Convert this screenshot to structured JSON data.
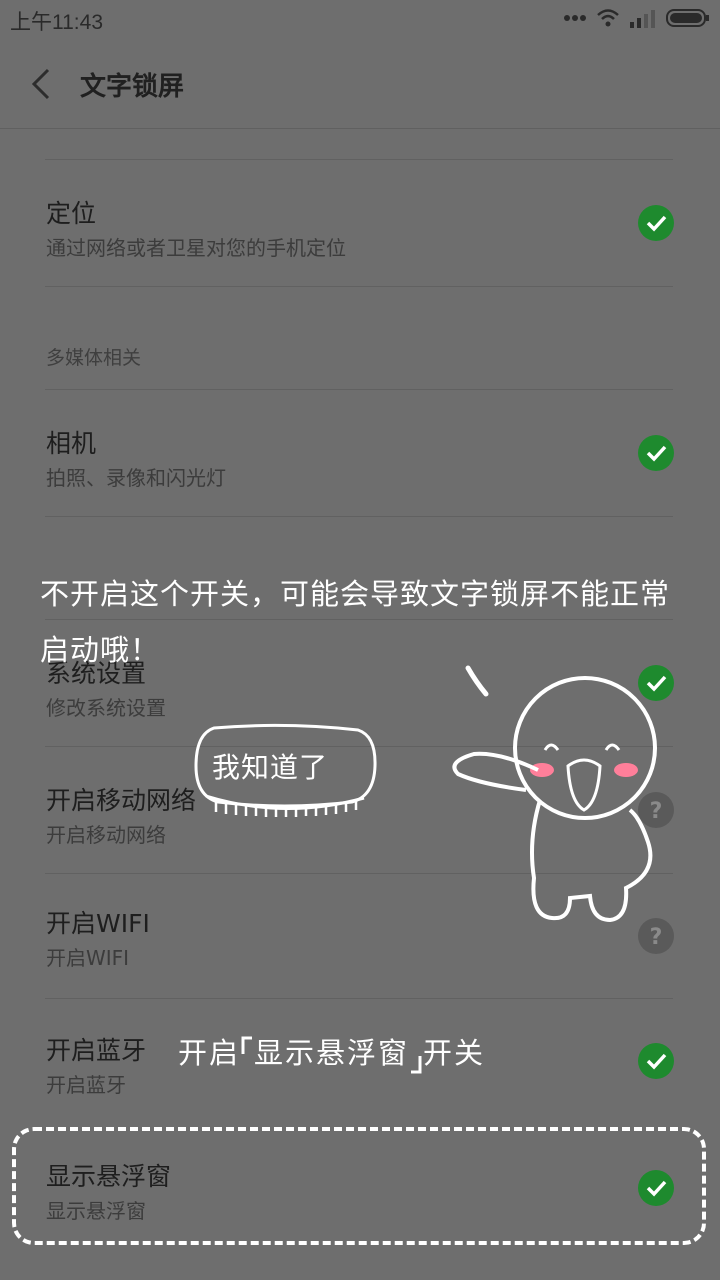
{
  "status_bar": {
    "time": "上午11:43"
  },
  "header": {
    "title": "文字锁屏"
  },
  "items": [
    {
      "title": "定位",
      "subtitle": "通过网络或者卫星对您的手机定位",
      "status": "check"
    },
    {
      "title": "相机",
      "subtitle": "拍照、录像和闪光灯",
      "status": "check"
    },
    {
      "title": "系统设置",
      "subtitle": "修改系统设置",
      "status": "check"
    },
    {
      "title": "开启移动网络",
      "subtitle": "开启移动网络",
      "status": "unknown"
    },
    {
      "title": "开启WIFI",
      "subtitle": "开启WIFI",
      "status": "unknown"
    },
    {
      "title": "开启蓝牙",
      "subtitle": "开启蓝牙",
      "status": "check"
    },
    {
      "title": "显示悬浮窗",
      "subtitle": "显示悬浮窗",
      "status": "check"
    }
  ],
  "section": {
    "multimedia": "多媒体相关"
  },
  "overlay": {
    "warning": "不开启这个开关，可能会导致文字锁屏不能正常启动哦！",
    "dismiss_button": "我知道了",
    "hint_prefix": "开启",
    "hint_target": "显示悬浮窗",
    "hint_suffix": "开关"
  },
  "colors": {
    "check_green": "#1e8a2e",
    "unknown_gray": "#5a5a5a",
    "dim_bg": "#6e6e6e"
  }
}
